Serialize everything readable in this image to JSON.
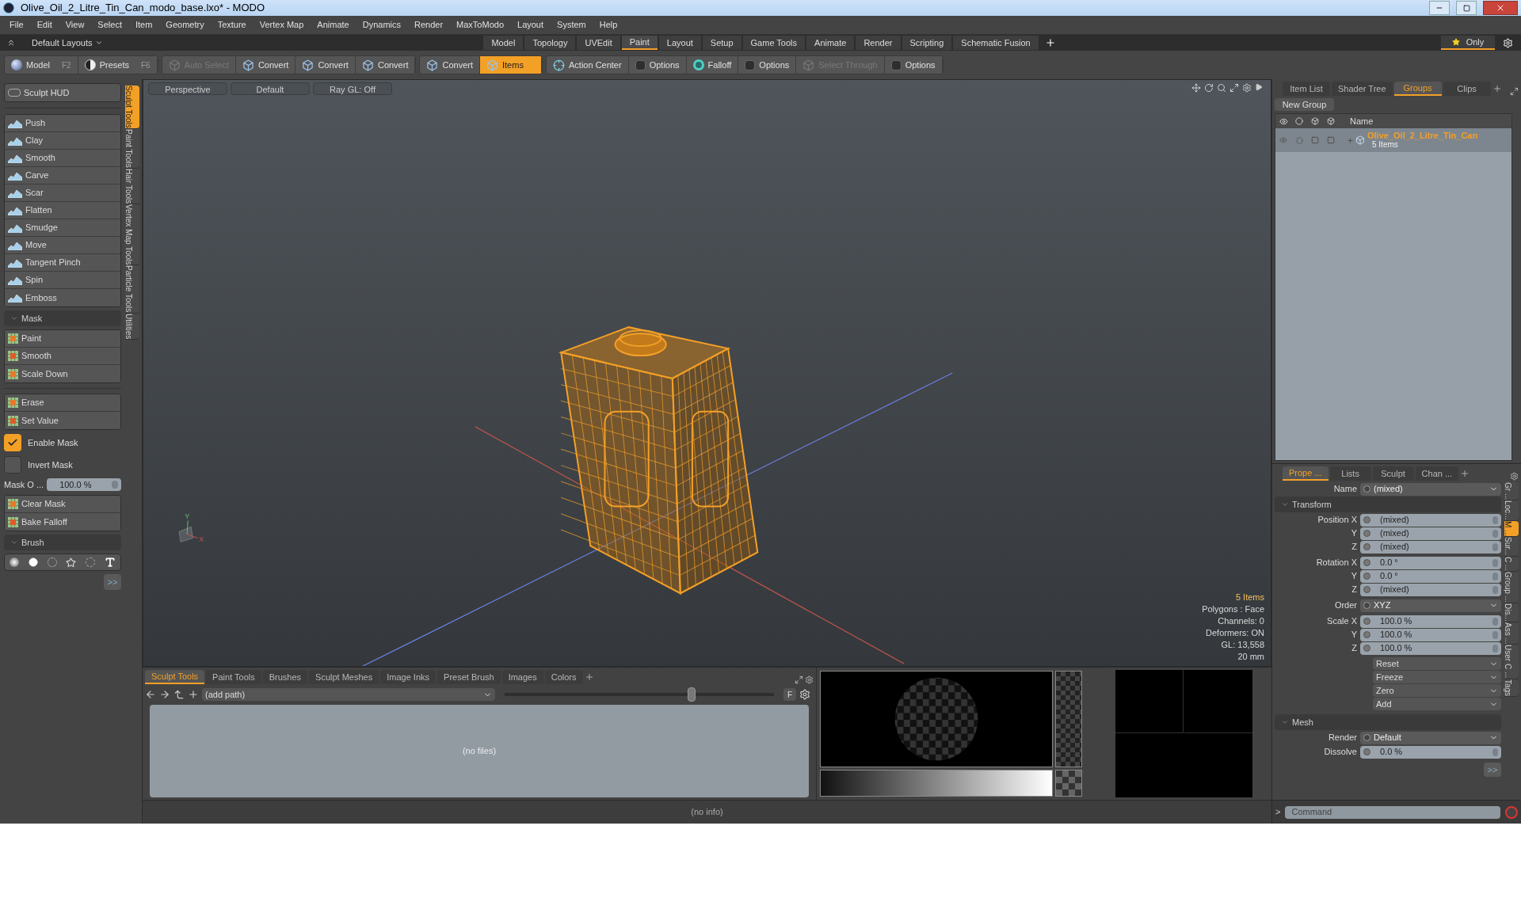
{
  "window": {
    "title": "Olive_Oil_2_Litre_Tin_Can_modo_base.lxo* - MODO"
  },
  "menu": [
    "File",
    "Edit",
    "View",
    "Select",
    "Item",
    "Geometry",
    "Texture",
    "Vertex Map",
    "Animate",
    "Dynamics",
    "Render",
    "MaxToModo",
    "Layout",
    "System",
    "Help"
  ],
  "layout_bar": {
    "layouts": "Default Layouts",
    "tabs": [
      {
        "label": "Model",
        "selected": false
      },
      {
        "label": "Topology",
        "selected": false
      },
      {
        "label": "UVEdit",
        "selected": false
      },
      {
        "label": "Paint",
        "selected": true
      },
      {
        "label": "Layout",
        "selected": false
      },
      {
        "label": "Setup",
        "selected": false
      },
      {
        "label": "Game Tools",
        "selected": false
      },
      {
        "label": "Animate",
        "selected": false
      },
      {
        "label": "Render",
        "selected": false
      },
      {
        "label": "Scripting",
        "selected": false
      },
      {
        "label": "Schematic Fusion",
        "selected": false
      }
    ],
    "only": "Only"
  },
  "toolbar": {
    "groups": [
      [
        {
          "kind": "mode",
          "label": "Model",
          "shortcut": "F2",
          "selected": false,
          "disabled": false
        },
        {
          "kind": "presets",
          "label": "Presets",
          "shortcut": "F6",
          "selected": false,
          "disabled": false
        }
      ],
      [
        {
          "kind": "select",
          "label": "Auto Select",
          "selected": false,
          "disabled": true
        },
        {
          "kind": "convert",
          "label": "Convert",
          "selected": false,
          "disabled": false
        },
        {
          "kind": "convert",
          "label": "Convert",
          "selected": false,
          "disabled": false
        },
        {
          "kind": "convert",
          "label": "Convert",
          "selected": false,
          "disabled": false
        }
      ],
      [
        {
          "kind": "convert",
          "label": "Convert",
          "selected": false,
          "disabled": false
        },
        {
          "kind": "convert",
          "label": "Items",
          "selected": true,
          "disabled": false
        }
      ],
      [
        {
          "kind": "target",
          "label": "Action Center",
          "selected": false,
          "disabled": false
        },
        {
          "kind": "check",
          "label": "Options",
          "selected": false,
          "disabled": false
        },
        {
          "kind": "falloff",
          "label": "Falloff",
          "selected": false,
          "disabled": false
        },
        {
          "kind": "check",
          "label": "Options",
          "selected": false,
          "disabled": false
        },
        {
          "kind": "select",
          "label": "Select Through",
          "selected": false,
          "disabled": true
        },
        {
          "kind": "check",
          "label": "Options",
          "selected": false,
          "disabled": false
        }
      ]
    ]
  },
  "left_panel": {
    "hud": "Sculpt HUD",
    "sculpt_tools": [
      "Push",
      "Clay",
      "Smooth",
      "Carve",
      "Scar",
      "Flatten",
      "Smudge",
      "Move",
      "Tangent Pinch",
      "Spin",
      "Emboss"
    ],
    "mask": {
      "title": "Mask",
      "tools": [
        "Paint",
        "Smooth",
        "Scale Down"
      ],
      "tools_2": [
        "Erase",
        "Set Value"
      ],
      "options": [
        {
          "label": "Enable Mask",
          "checked": true
        },
        {
          "label": "Invert Mask",
          "checked": false
        }
      ],
      "opacity": {
        "label": "Mask O ...",
        "value": "100.0 %"
      },
      "actions": [
        "Clear Mask",
        "Bake Falloff"
      ]
    },
    "brush": {
      "title": "Brush",
      "more": ">>"
    },
    "side_tabs": [
      {
        "label": "Sculpt Tools",
        "selected": true
      },
      {
        "label": "Paint Tools",
        "selected": false
      },
      {
        "label": "Hair Tools",
        "selected": false
      },
      {
        "label": "Vertex Map Tools",
        "selected": false
      },
      {
        "label": "Particle Tools",
        "selected": false
      },
      {
        "label": "Utilities",
        "selected": false
      }
    ]
  },
  "viewport": {
    "header": [
      "Perspective",
      "Default",
      "Ray GL: Off"
    ],
    "axis_labels": [
      "Y",
      "X"
    ],
    "info": [
      {
        "text": "5 Items",
        "highlight": true
      },
      {
        "text": "Polygons : Face",
        "highlight": false
      },
      {
        "text": "Channels: 0",
        "highlight": false
      },
      {
        "text": "Deformers: ON",
        "highlight": false
      },
      {
        "text": "GL: 13,558",
        "highlight": false
      },
      {
        "text": "20 mm",
        "highlight": false
      }
    ]
  },
  "bottom_panel": {
    "tabs": [
      {
        "label": "Sculpt Tools",
        "selected": true
      },
      {
        "label": "Paint Tools",
        "selected": false
      },
      {
        "label": "Brushes",
        "selected": false
      },
      {
        "label": "Sculpt Meshes",
        "selected": false
      },
      {
        "label": "Image Inks",
        "selected": false
      },
      {
        "label": "Preset Brush",
        "selected": false
      },
      {
        "label": "Images",
        "selected": false
      },
      {
        "label": "Colors",
        "selected": false
      }
    ],
    "path": "(add path)",
    "slider": {
      "level": 0.7
    },
    "filter": "F",
    "empty": "(no files)"
  },
  "status_bar": "(no info)",
  "groups_panel": {
    "tabs": [
      {
        "label": "Item List",
        "selected": false
      },
      {
        "label": "Shader Tree",
        "selected": false
      },
      {
        "label": "Groups",
        "selected": true
      },
      {
        "label": "Clips",
        "selected": false
      }
    ],
    "new_group": "New Group",
    "columns": [
      "Name"
    ],
    "rows": [
      {
        "name": "Olive_Oil_2_Litre_Tin_Can",
        "count": "5 Items"
      }
    ]
  },
  "properties": {
    "tabs": [
      {
        "label": "Prope ...",
        "selected": true
      },
      {
        "label": "Lists",
        "selected": false
      },
      {
        "label": "Sculpt",
        "selected": false
      },
      {
        "label": "Chan ...",
        "selected": false
      }
    ],
    "name": {
      "label": "Name",
      "value": "(mixed)"
    },
    "transform": {
      "title": "Transform",
      "groups": [
        {
          "kind": "fields",
          "rows": [
            {
              "label": "Position X",
              "value": "(mixed)"
            },
            {
              "label": "Y",
              "value": "(mixed)"
            },
            {
              "label": "Z",
              "value": "(mixed)"
            }
          ]
        },
        {
          "kind": "fields",
          "rows": [
            {
              "label": "Rotation X",
              "value": "0.0 °"
            },
            {
              "label": "Y",
              "value": "0.0 °"
            },
            {
              "label": "Z",
              "value": "(mixed)"
            }
          ]
        },
        {
          "kind": "dropdown",
          "rows": [
            {
              "label": "Order",
              "value": "XYZ"
            }
          ]
        },
        {
          "kind": "fields",
          "rows": [
            {
              "label": "Scale X",
              "value": "100.0 %"
            },
            {
              "label": "Y",
              "value": "100.0 %"
            },
            {
              "label": "Z",
              "value": "100.0 %"
            }
          ]
        }
      ],
      "actions": [
        "Reset",
        "Freeze",
        "Zero",
        "Add"
      ]
    },
    "mesh": {
      "title": "Mesh",
      "rows": [
        {
          "kind": "dropdown",
          "label": "Render",
          "value": "Default"
        },
        {
          "kind": "field",
          "label": "Dissolve",
          "value": "0.0 %"
        }
      ]
    },
    "more": ">>",
    "side_tabs": [
      {
        "label": "Gr ...",
        "selected": false
      },
      {
        "label": "Loc...",
        "selected": false
      },
      {
        "label": "M ...",
        "selected": true
      },
      {
        "label": "Sur...",
        "selected": false
      },
      {
        "label": "C ...",
        "selected": false
      },
      {
        "label": "Group ...",
        "selected": false
      },
      {
        "label": "Dis...",
        "selected": false
      },
      {
        "label": "Ass ...",
        "selected": false
      },
      {
        "label": "User C ...",
        "selected": false
      },
      {
        "label": "Tags",
        "selected": false
      }
    ]
  },
  "command": {
    "prompt": ">",
    "placeholder": "Command"
  }
}
